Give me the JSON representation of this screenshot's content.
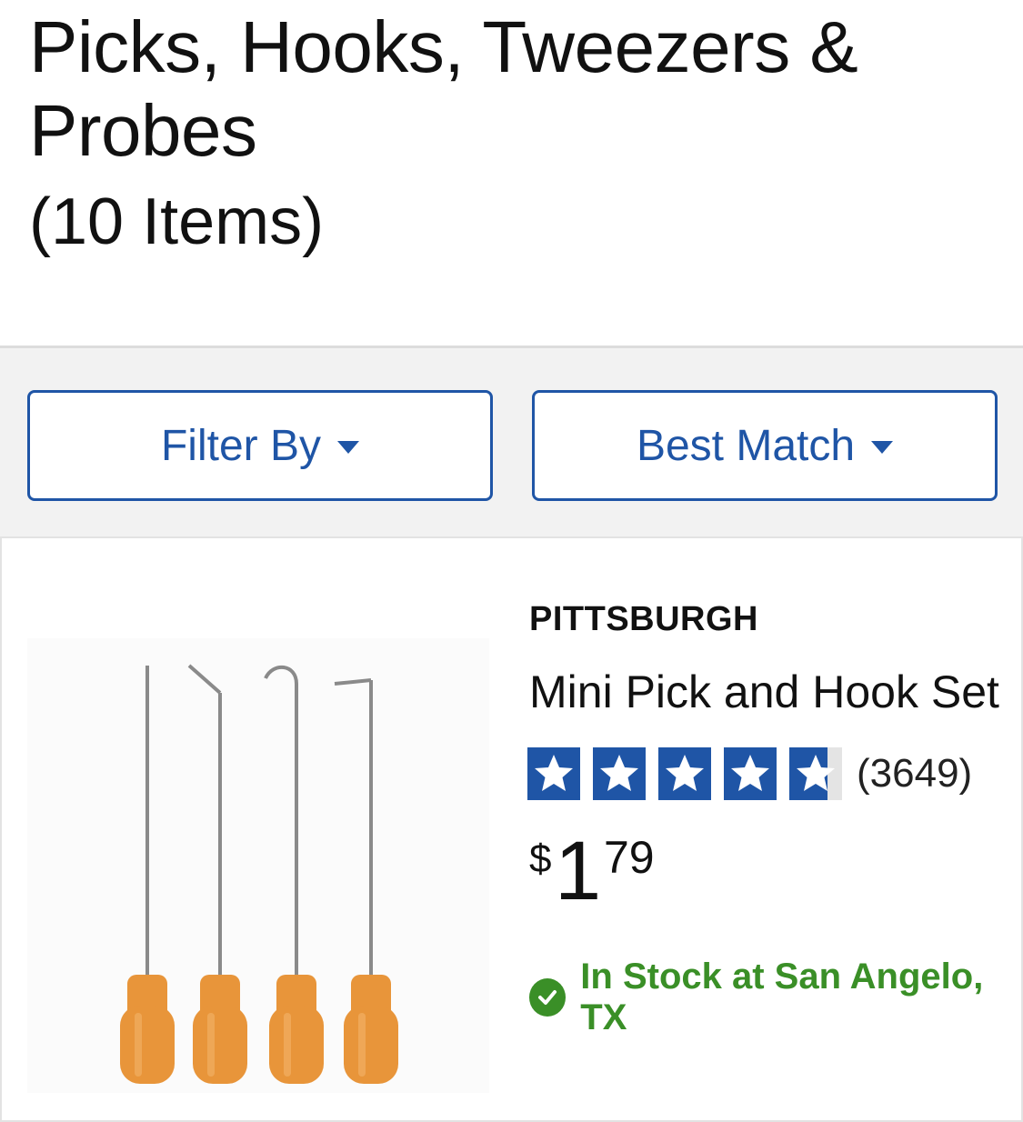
{
  "header": {
    "title": "Picks, Hooks, Tweezers & Probes",
    "item_count": "(10 Items)"
  },
  "toolbar": {
    "filter_label": "Filter By",
    "sort_label": "Best Match"
  },
  "product": {
    "brand": "PITTSBURGH",
    "name": "Mini Pick and Hook Set",
    "rating": 4.5,
    "rating_max": 5,
    "review_count": "(3649)",
    "price_currency": "$",
    "price_dollars": "1",
    "price_cents": "79",
    "stock_status": "In Stock at San Angelo, TX",
    "image_icon": "pick-and-hook-set-image"
  },
  "colors": {
    "brand_blue": "#1f55a6",
    "stock_green": "#3a8f27",
    "handle_orange": "#e8953a"
  }
}
